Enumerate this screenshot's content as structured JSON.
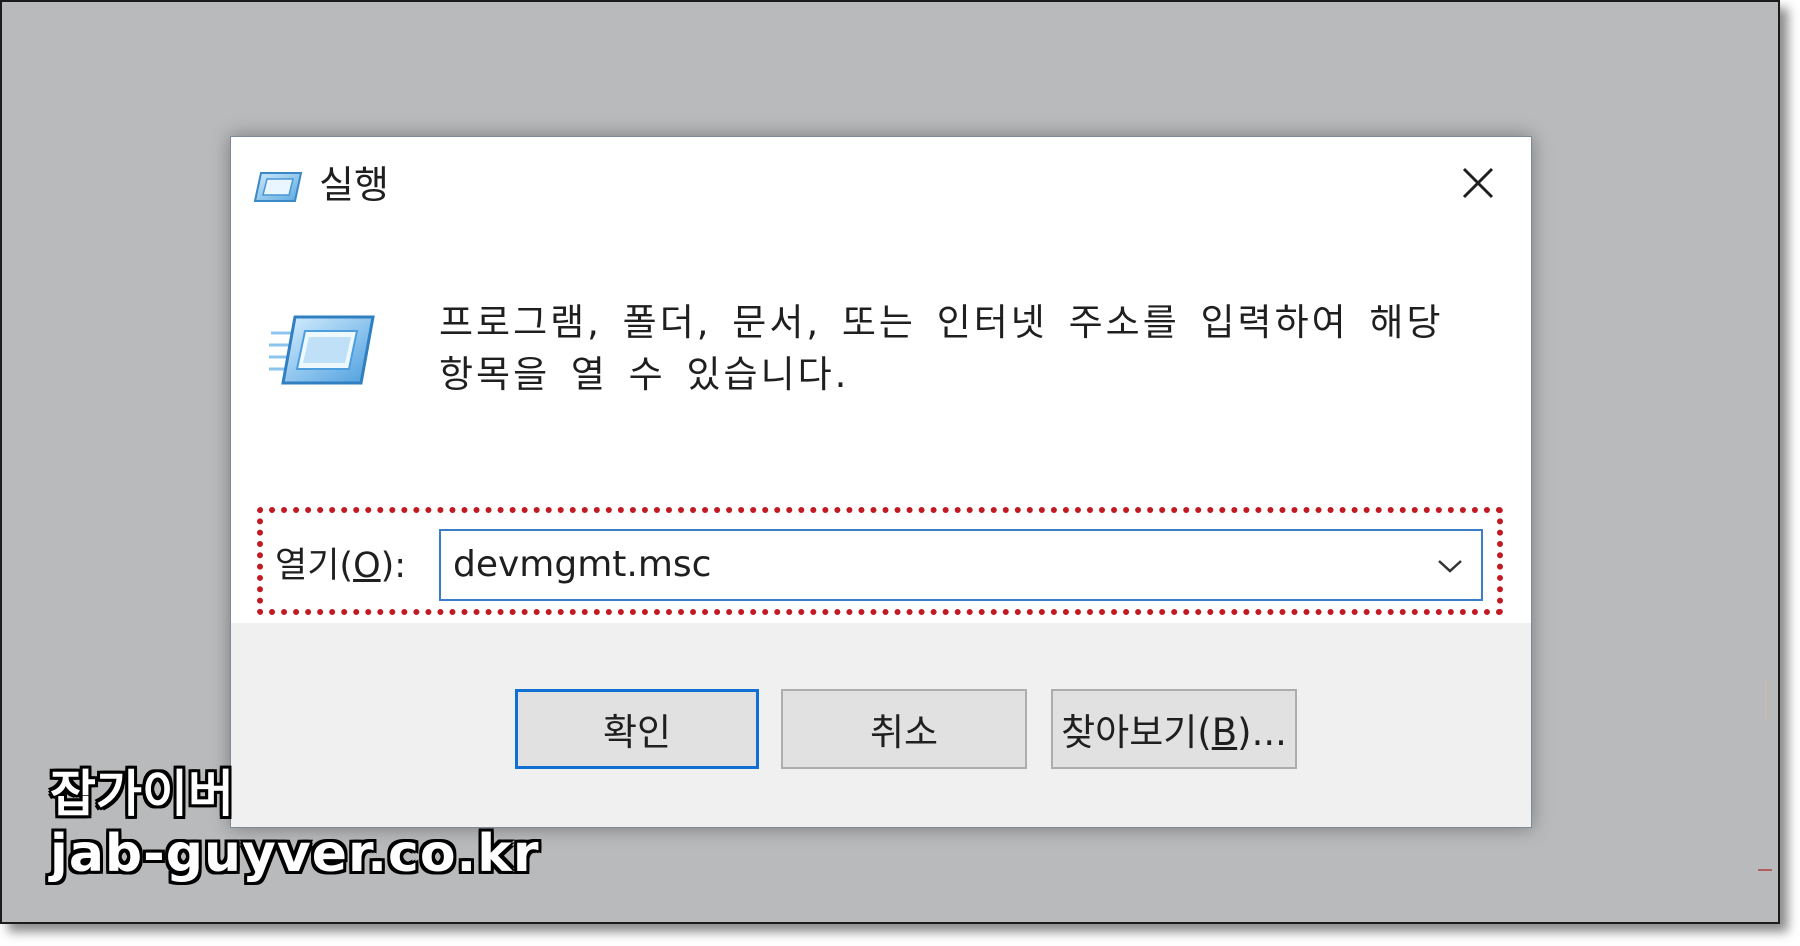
{
  "dialog": {
    "title": "실행",
    "description": "프로그램, 폴더, 문서, 또는 인터넷 주소를 입력하여 해당 항목을 열 수 있습니다.",
    "open_label_prefix": "열기(",
    "open_label_key": "O",
    "open_label_suffix": "):",
    "open_value": "devmgmt.msc",
    "buttons": {
      "ok": "확인",
      "cancel": "취소",
      "browse_prefix": "찾아보기(",
      "browse_key": "B",
      "browse_suffix": ")..."
    }
  },
  "watermark": {
    "line1": "잡가이버",
    "line2": "jab-guyver.co.kr"
  },
  "colors": {
    "highlight": "#c21a22",
    "accent": "#0f6fd2",
    "backdrop": "#b9babc"
  },
  "icons": [
    "run-icon",
    "close-icon",
    "chevron-down-icon"
  ]
}
